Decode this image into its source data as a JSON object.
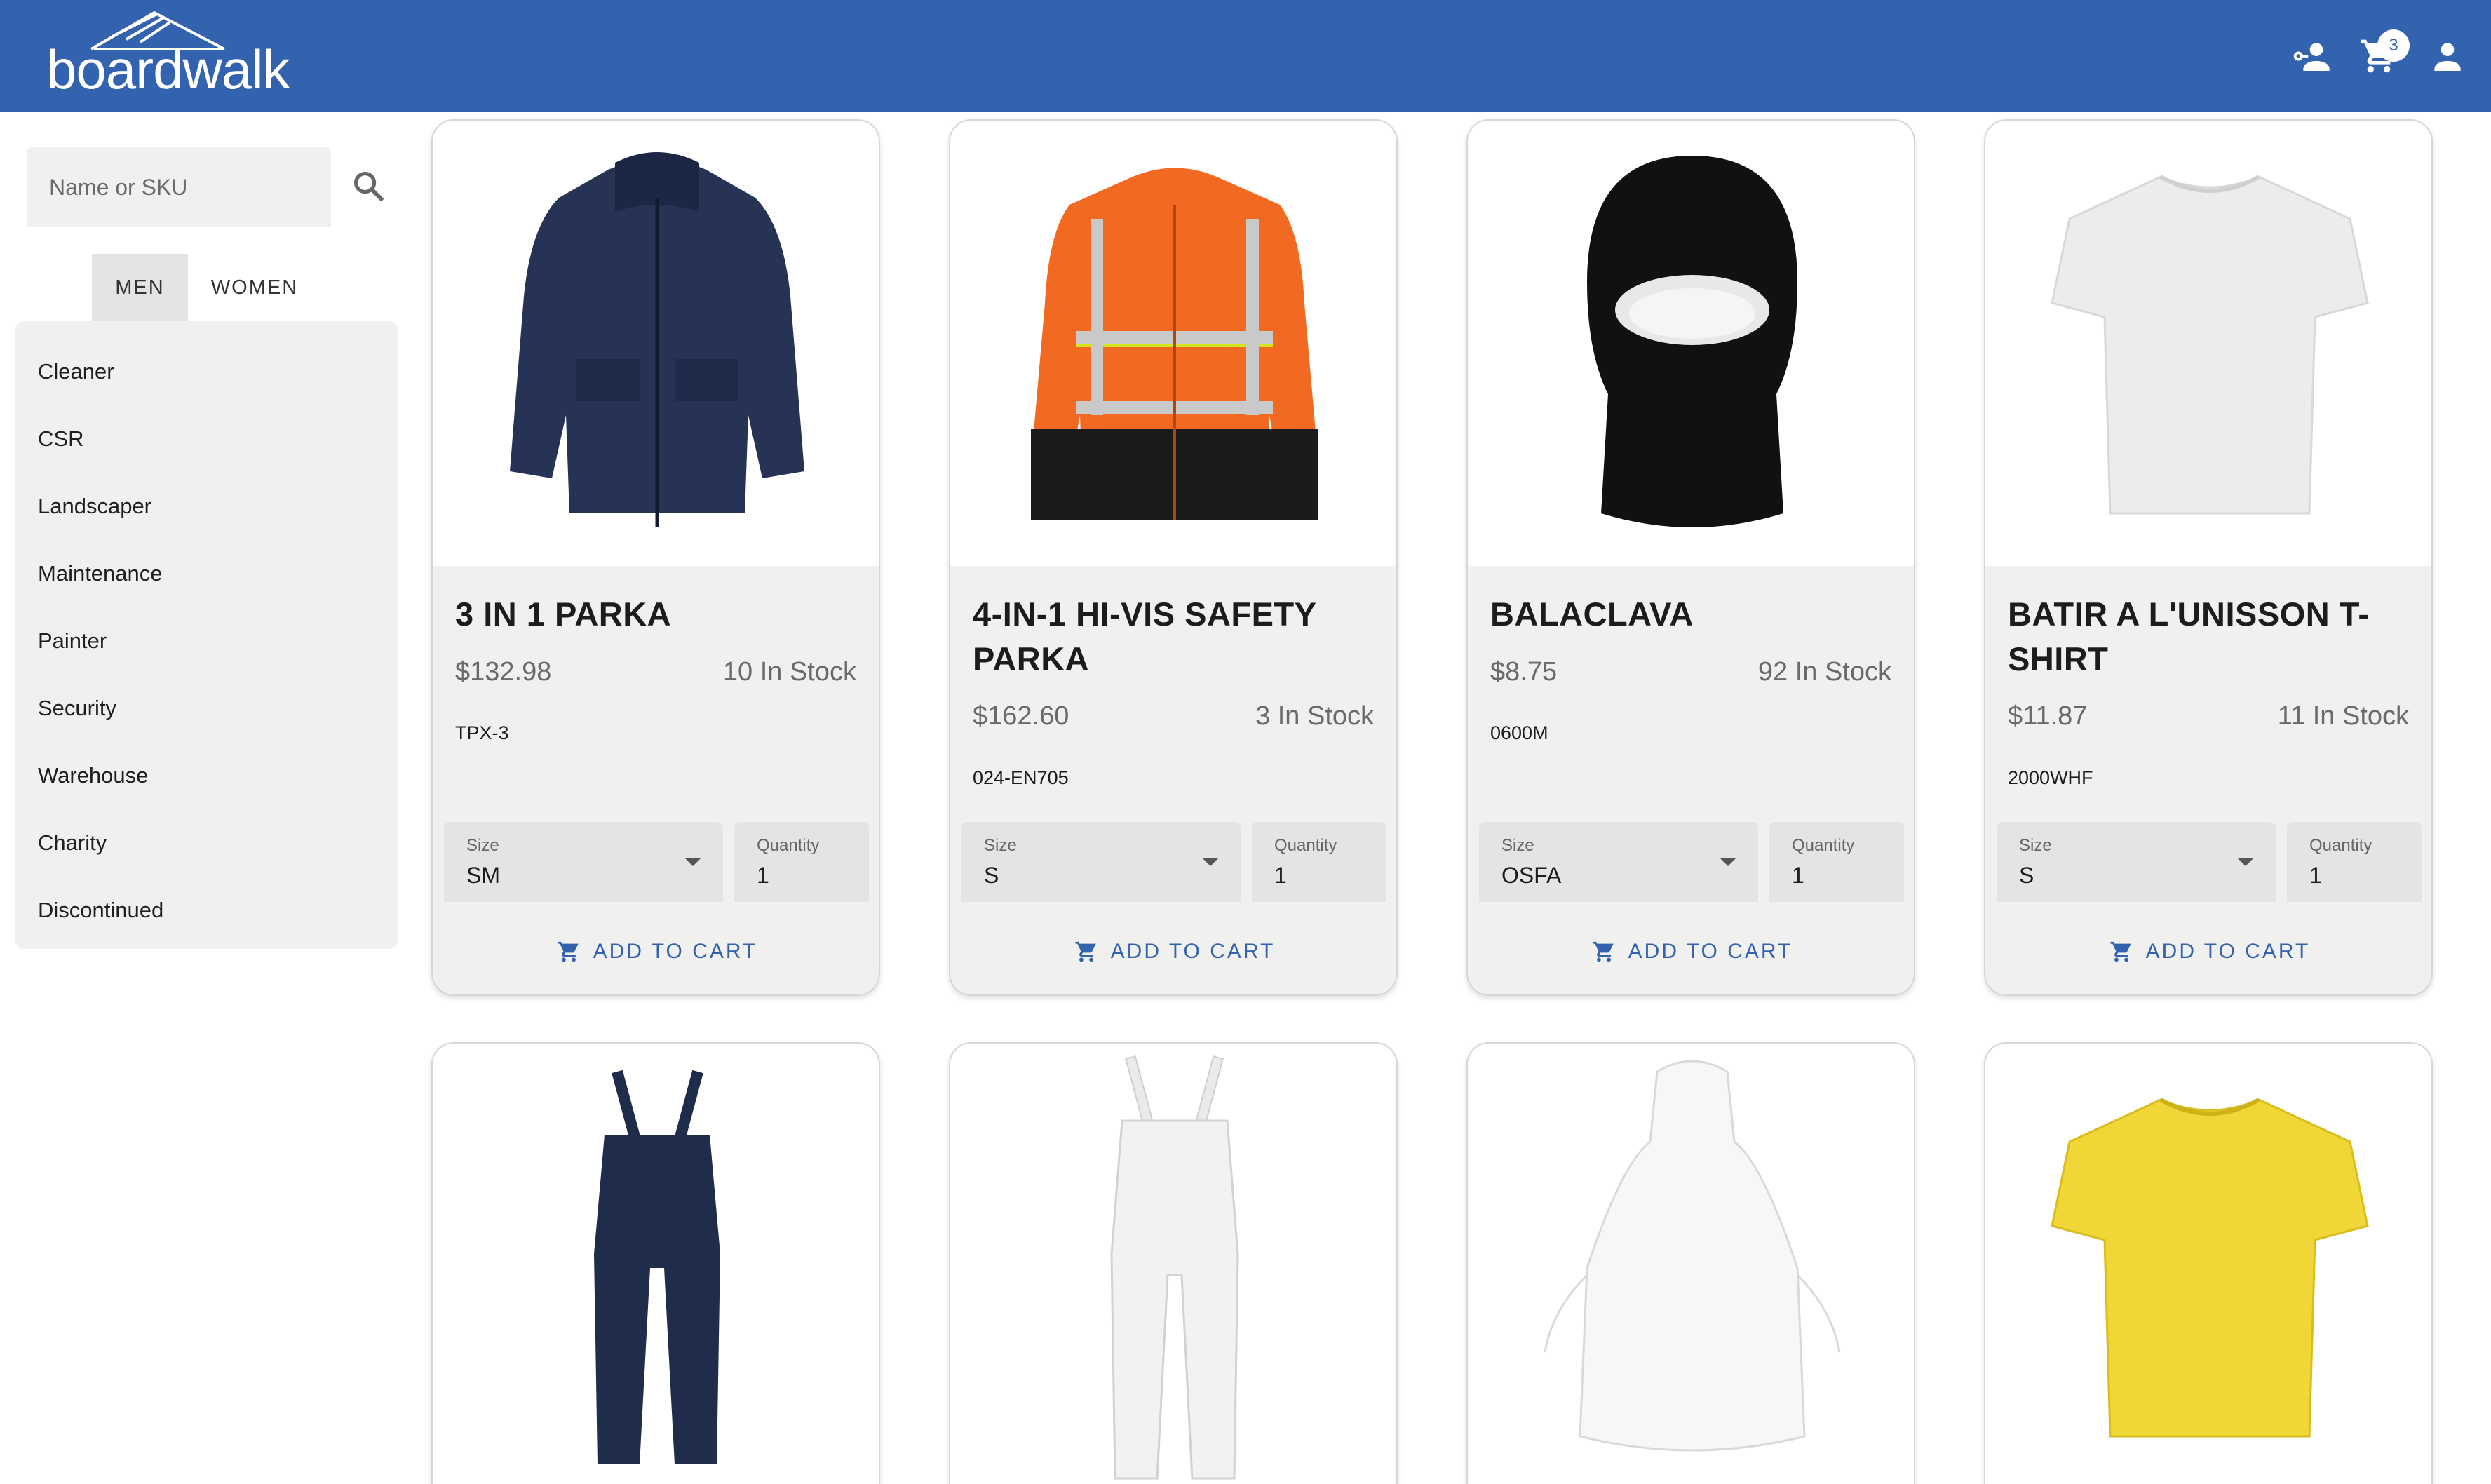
{
  "brand": {
    "logo_text": "boardwalk"
  },
  "header": {
    "cart_count": "3"
  },
  "search": {
    "placeholder": "Name or SKU"
  },
  "gender_tabs": [
    "MEN",
    "WOMEN"
  ],
  "categories": [
    "Cleaner",
    "CSR",
    "Landscaper",
    "Maintenance",
    "Painter",
    "Security",
    "Warehouse",
    "Charity",
    "Discontinued"
  ],
  "products": [
    {
      "title": "3 IN 1 PARKA",
      "price": "$132.98",
      "stock": "10 In Stock",
      "sku": "TPX-3",
      "size": "SM",
      "quantity": "1"
    },
    {
      "title": "4-IN-1 HI-VIS SAFETY PARKA",
      "price": "$162.60",
      "stock": "3 In Stock",
      "sku": "024-EN705",
      "size": "S",
      "quantity": "1"
    },
    {
      "title": "BALACLAVA",
      "price": "$8.75",
      "stock": "92 In Stock",
      "sku": "0600M",
      "size": "OSFA",
      "quantity": "1"
    },
    {
      "title": "BATIR A L'UNISSON T-SHIRT",
      "price": "$11.87",
      "stock": "11 In Stock",
      "sku": "2000WHF",
      "size": "S",
      "quantity": "1"
    }
  ],
  "labels": {
    "size": "Size",
    "quantity": "Quantity",
    "add_to_cart": "ADD TO CART"
  },
  "colors": {
    "header": "#3362ae",
    "accent": "#3362ae",
    "card_bg": "#f0f0ef"
  }
}
